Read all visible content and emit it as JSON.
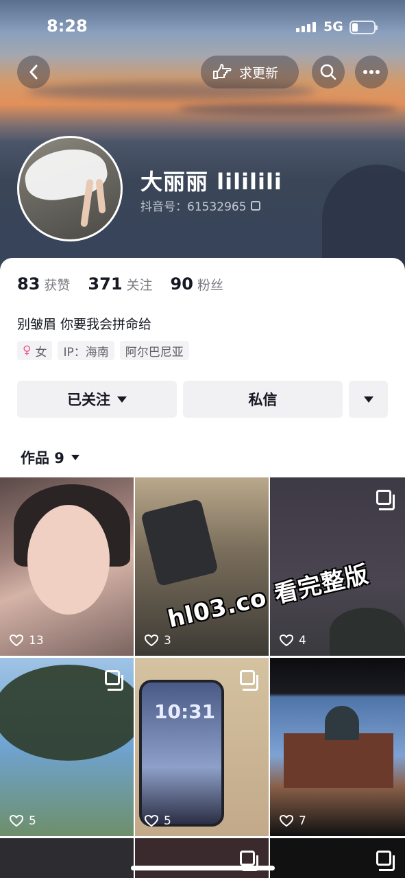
{
  "status_bar": {
    "time": "8:28",
    "network": "5G"
  },
  "header": {
    "update_label": "求更新",
    "name": "大丽丽 lililili",
    "douyin_id": "抖音号：61532965"
  },
  "stats": [
    {
      "value": "83",
      "label": "获赞"
    },
    {
      "value": "371",
      "label": "关注"
    },
    {
      "value": "90",
      "label": "粉丝"
    }
  ],
  "bio": "别皱眉 你要我会拼命给",
  "tags": {
    "gender": "女",
    "ip": "IP：海南",
    "location": "阿尔巴尼亚"
  },
  "actions": {
    "follow_label": "已关注",
    "message_label": "私信"
  },
  "works": {
    "tab_label": "作品 9"
  },
  "tiles": [
    {
      "likes": "13"
    },
    {
      "likes": "3"
    },
    {
      "likes": "4"
    },
    {
      "likes": "5"
    },
    {
      "likes": "5",
      "screen_time": "10:31"
    },
    {
      "likes": "7"
    }
  ],
  "watermark": "hl03.co 看完整版",
  "colors": {
    "accent_gender": "#f2548c",
    "button_bg": "#f1f1f3"
  }
}
